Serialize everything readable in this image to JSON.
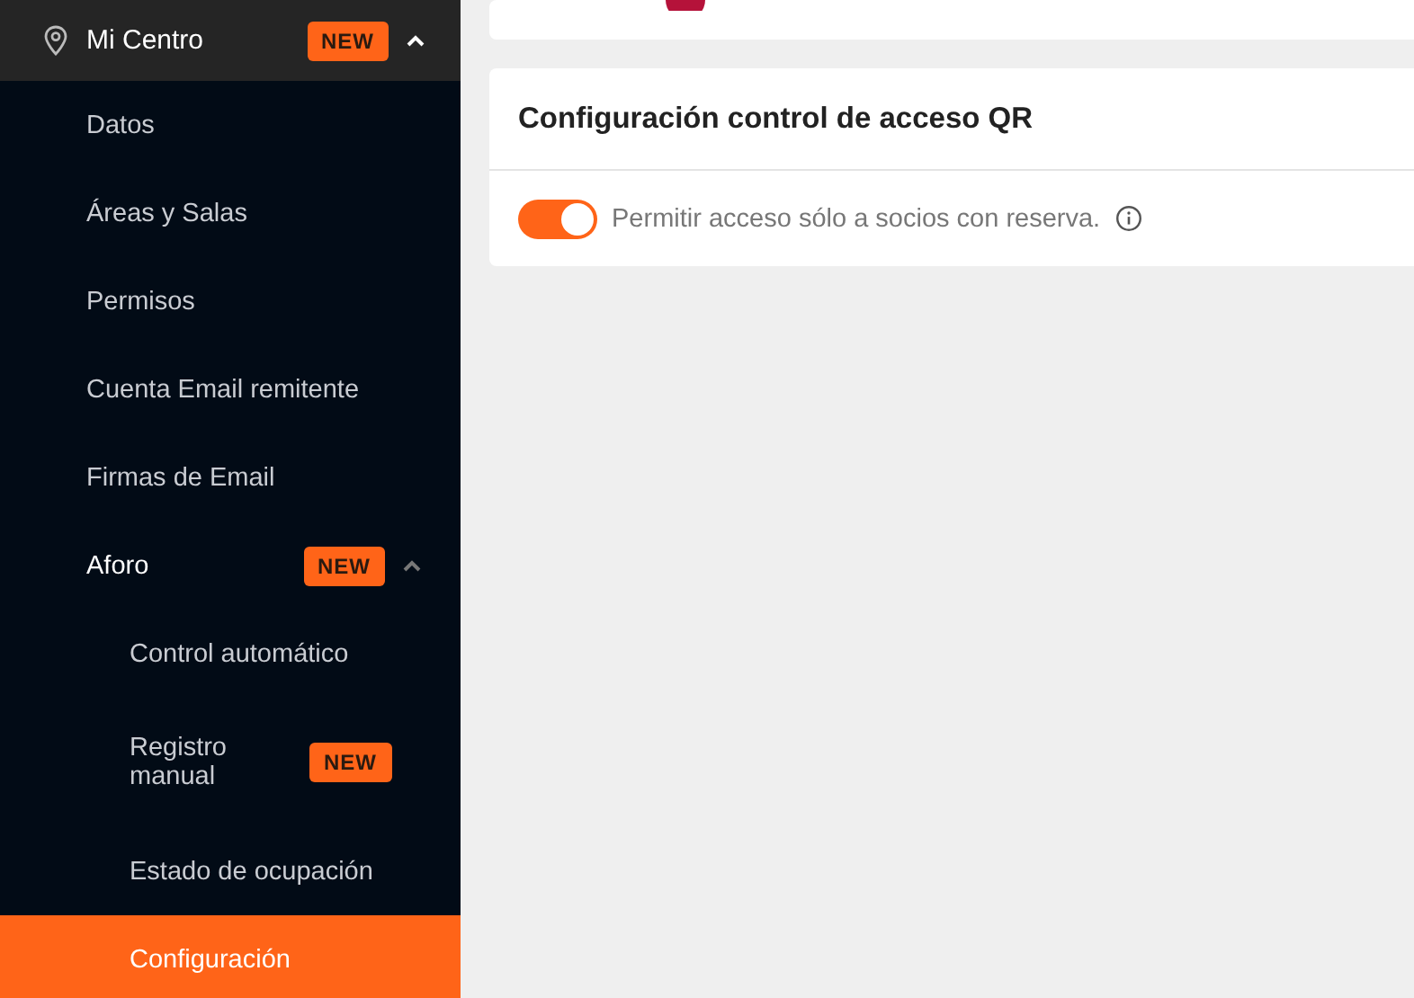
{
  "sidebar": {
    "header": {
      "label": "Mi Centro",
      "badge": "NEW",
      "expanded": true
    },
    "items": [
      {
        "label": "Datos",
        "selected": false
      },
      {
        "label": "Áreas y Salas",
        "selected": false
      },
      {
        "label": "Permisos",
        "selected": false
      },
      {
        "label": "Cuenta Email remitente",
        "selected": false
      },
      {
        "label": "Firmas de Email",
        "selected": false
      },
      {
        "label": "Aforo",
        "selected": false,
        "badge": "NEW",
        "expanded": true,
        "children": [
          {
            "label": "Control automático",
            "selected": false
          },
          {
            "label": "Registro manual",
            "selected": false,
            "badge": "NEW"
          },
          {
            "label": "Estado de ocupación",
            "selected": false
          },
          {
            "label": "Configuración",
            "selected": true
          }
        ]
      }
    ]
  },
  "card": {
    "title": "Configuración control de acceso QR",
    "setting": {
      "label": "Permitir acceso sólo a socios con reserva.",
      "on": true
    }
  }
}
